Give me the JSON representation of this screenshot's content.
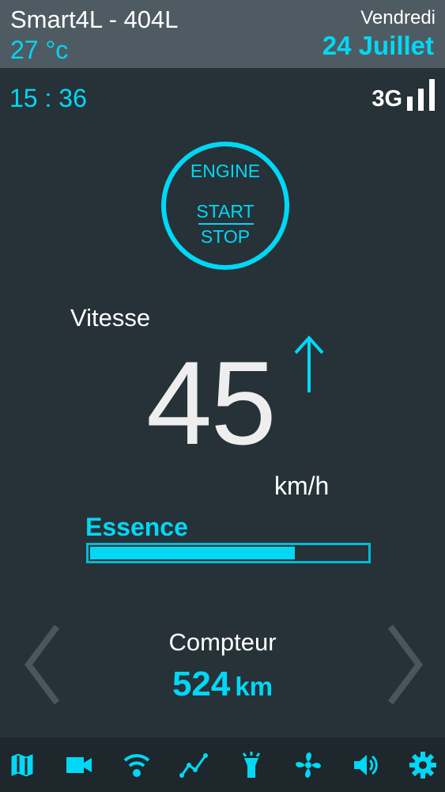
{
  "header": {
    "car_name": "Smart4L - 404L",
    "temperature": "27 °c",
    "day": "Vendredi",
    "date": "24 Juillet"
  },
  "status": {
    "time": "15 : 36",
    "network": "3G",
    "signal_icon": "signal-bars-icon"
  },
  "engine": {
    "label": "ENGINE",
    "start": "START",
    "stop": "STOP"
  },
  "speed": {
    "label": "Vitesse",
    "value": "45",
    "unit": "km/h",
    "trend_icon": "arrow-up-icon"
  },
  "fuel": {
    "label": "Essence",
    "level_percent": 74
  },
  "odometer": {
    "label": "Compteur",
    "value": "524",
    "unit": "km"
  },
  "navigation": {
    "left_icon": "chevron-left-icon",
    "right_icon": "chevron-right-icon"
  },
  "bottom_bar": {
    "icons": [
      "map-icon",
      "video-camera-icon",
      "wifi-icon",
      "chart-line-icon",
      "flashlight-icon",
      "fan-icon",
      "volume-icon",
      "gear-icon"
    ]
  },
  "colors": {
    "accent": "#00d8f5",
    "background": "#263238",
    "header": "#4f5b62",
    "bottom_bar": "#1e272c"
  }
}
